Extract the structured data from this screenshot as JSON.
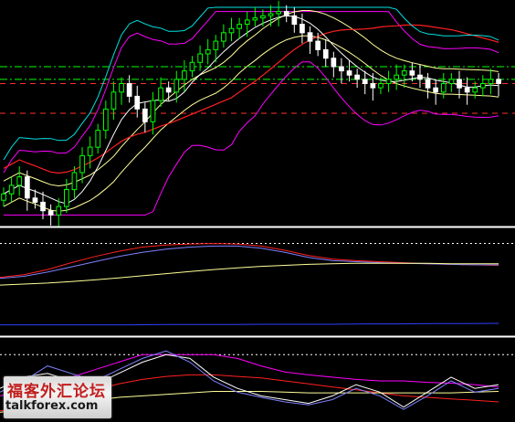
{
  "watermark": {
    "text_cn": "福客外汇论坛",
    "text_en": "talkforex.com"
  },
  "colors": {
    "background": "#000000",
    "bull_candle": "#00ff00",
    "bear_candle": "#ffffff",
    "bollinger_outer": "#ff00ff",
    "bollinger_mid": "#ffff99",
    "ma_long": "#ff2020",
    "ma_mid": "#ffffff",
    "ma_upper": "#00e0e0",
    "level_green": "#00ff00",
    "level_red": "#ff3030",
    "panel_separator": "#ffffff"
  },
  "chart_data": [
    {
      "type": "candlestick",
      "panel": "price",
      "title": "",
      "grid": false,
      "ylim": [
        0,
        100
      ],
      "bars": 64,
      "candles_close": [
        12,
        16,
        20,
        10,
        8,
        4,
        2,
        6,
        14,
        22,
        30,
        34,
        42,
        52,
        60,
        64,
        58,
        52,
        46,
        56,
        62,
        60,
        66,
        70,
        74,
        78,
        80,
        84,
        88,
        90,
        92,
        94,
        95,
        96,
        97,
        98,
        96,
        92,
        88,
        84,
        80,
        76,
        72,
        70,
        68,
        66,
        64,
        62,
        64,
        66,
        68,
        70,
        68,
        66,
        62,
        60,
        64,
        66,
        62,
        60,
        62,
        64,
        66,
        64
      ],
      "series": [
        {
          "name": "",
          "role": "bollinger_upper"
        },
        {
          "name": "",
          "role": "bollinger_mid"
        },
        {
          "name": "",
          "role": "bollinger_lower"
        },
        {
          "name": "",
          "role": "ma_long"
        },
        {
          "name": "",
          "role": "ma_upper"
        }
      ],
      "horizontal_levels": [
        {
          "style": "dash-dot",
          "color": "green",
          "value": 72
        },
        {
          "style": "dash-dot",
          "color": "green",
          "value": 66
        },
        {
          "style": "dashed",
          "color": "red",
          "value": 64
        },
        {
          "style": "dashed",
          "color": "red",
          "value": 50
        }
      ]
    },
    {
      "type": "line",
      "panel": "oscillator_1",
      "title": "",
      "ylim": [
        0,
        100
      ],
      "dotted_level": 85,
      "series": [
        {
          "name": "",
          "color": "#ff2020",
          "values": [
            20,
            25,
            35,
            48,
            60,
            70,
            78,
            82,
            84,
            85,
            84,
            80,
            72,
            62,
            55,
            52,
            50,
            48,
            46,
            45,
            44,
            43
          ]
        },
        {
          "name": "",
          "color": "#8080ff",
          "values": [
            18,
            22,
            30,
            40,
            50,
            60,
            68,
            74,
            78,
            80,
            80,
            76,
            68,
            58,
            52,
            50,
            48,
            47,
            46,
            45,
            44,
            44
          ]
        },
        {
          "name": "",
          "color": "#ffff99",
          "values": [
            5,
            7,
            9,
            12,
            15,
            19,
            23,
            27,
            31,
            35,
            38,
            41,
            43,
            45,
            46,
            47,
            47,
            47,
            47,
            46,
            46,
            46
          ]
        }
      ]
    },
    {
      "type": "line",
      "panel": "volume_like",
      "title": "",
      "ylim": [
        0,
        100
      ],
      "series": [
        {
          "name": "",
          "color": "#3040ff",
          "values": [
            20,
            20,
            20,
            20,
            20,
            21,
            21,
            21,
            22,
            22,
            22,
            23,
            23,
            24,
            24,
            25
          ]
        }
      ]
    },
    {
      "type": "line",
      "panel": "oscillator_2",
      "title": "",
      "ylim": [
        0,
        100
      ],
      "dotted_level": 85,
      "series": [
        {
          "name": "",
          "color": "#ff00ff",
          "values": [
            30,
            35,
            45,
            55,
            65,
            75,
            85,
            85,
            85,
            85,
            80,
            70,
            62,
            58,
            55,
            52,
            50,
            50,
            48,
            47,
            45,
            42
          ]
        },
        {
          "name": "",
          "color": "#ff2020",
          "values": [
            10,
            15,
            22,
            30,
            38,
            46,
            52,
            56,
            58,
            58,
            56,
            54,
            50,
            46,
            42,
            38,
            34,
            30,
            28,
            26,
            24,
            22
          ]
        },
        {
          "name": "",
          "color": "#ffff99",
          "values": [
            8,
            12,
            16,
            20,
            24,
            28,
            30,
            32,
            34,
            36,
            36,
            36,
            35,
            34,
            34,
            34,
            34,
            34,
            34,
            34,
            35,
            36
          ]
        },
        {
          "name": "",
          "color": "#ffffff",
          "values": [
            40,
            55,
            60,
            50,
            45,
            60,
            75,
            85,
            80,
            55,
            40,
            30,
            25,
            20,
            30,
            45,
            35,
            15,
            35,
            55,
            40,
            45
          ]
        },
        {
          "name": "",
          "color": "#8080ff",
          "values": [
            35,
            50,
            70,
            60,
            50,
            65,
            80,
            90,
            75,
            50,
            35,
            28,
            22,
            18,
            25,
            40,
            30,
            12,
            30,
            50,
            35,
            40
          ]
        }
      ]
    }
  ]
}
